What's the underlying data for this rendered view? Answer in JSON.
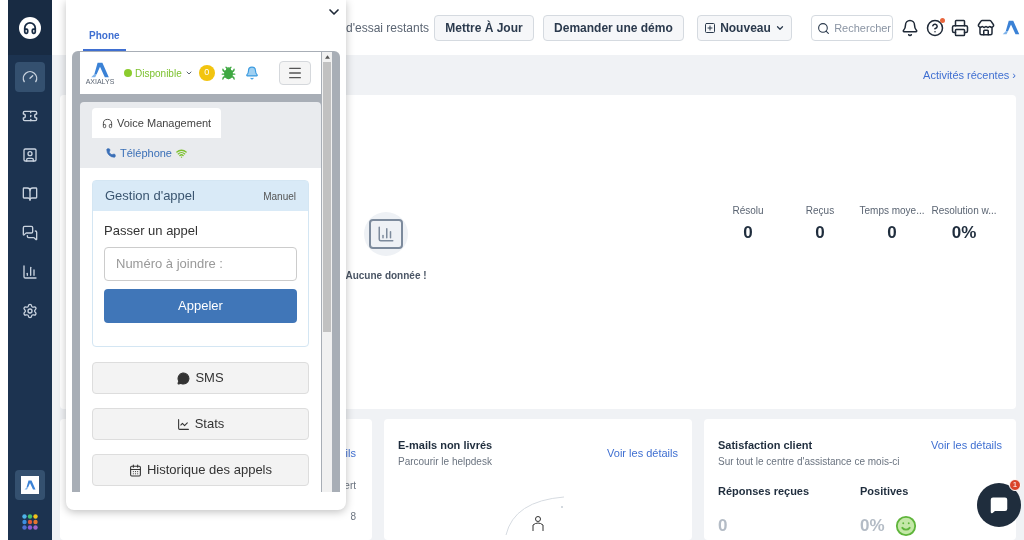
{
  "sidebar": {
    "items": [
      {
        "selected": true
      },
      {
        "selected": false
      },
      {
        "selected": false
      },
      {
        "selected": false
      },
      {
        "selected": false
      },
      {
        "selected": false
      },
      {
        "selected": false
      }
    ]
  },
  "header": {
    "trial_text": "d'essai restants",
    "buttons": [
      "Mettre À Jour",
      "Demander une démo"
    ],
    "new_button": "Nouveau",
    "search": {
      "placeholder": "Rechercher"
    }
  },
  "recent_activity_link": "Activités récentes ›",
  "overview": {
    "empty_state": "Aucune donnée !",
    "stats": [
      {
        "label": "Résolu",
        "value": "0"
      },
      {
        "label": "Reçus",
        "value": "0"
      },
      {
        "label": "Temps moye...",
        "value": "0"
      },
      {
        "label": "Resolution w...",
        "value": "0%"
      }
    ]
  },
  "cards": [
    {
      "fragments": [
        "ils",
        "ert",
        "8"
      ]
    },
    {
      "title": "E-mails non livrés",
      "subtitle": "Parcourir le helpdesk",
      "link": "Voir les détails"
    },
    {
      "title": "Satisfaction client",
      "subtitle": "Sur tout le centre d'assistance ce mois-ci",
      "link": "Voir les détails",
      "metrics": [
        {
          "label": "Réponses reçues",
          "value": "0"
        },
        {
          "label": "Positives",
          "value": "0%"
        }
      ]
    }
  ],
  "chat_badge": "1",
  "phone_popup": {
    "tabs": [
      {
        "label": "Phone",
        "selected": true
      }
    ],
    "logo_text": "AXIALYS",
    "status": "Disponible",
    "counter": "0",
    "channel_tab": "Voice Management",
    "line": "Téléphone",
    "panel": {
      "title": "Gestion d'appel",
      "mode": "Manuel",
      "section": "Passer un appel",
      "number_field": {
        "placeholder": "Numéro à joindre :"
      },
      "call_button": "Appeler"
    },
    "actions": [
      "SMS",
      "Stats",
      "Historique des appels"
    ]
  }
}
